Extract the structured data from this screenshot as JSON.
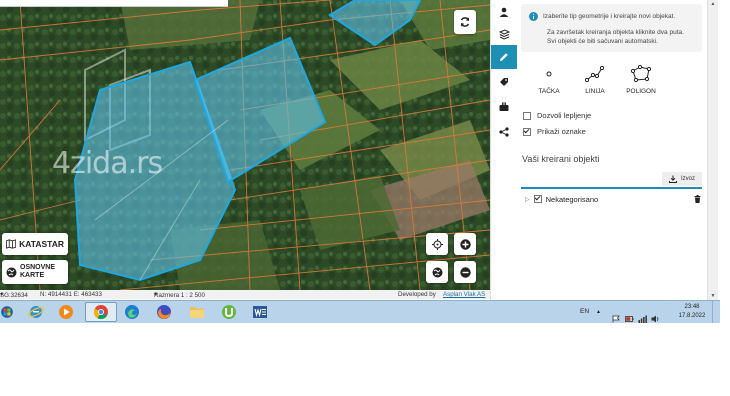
{
  "map": {
    "watermark": "4zida.rs",
    "buttons": {
      "refresh_icon": "refresh-icon",
      "locate_icon": "locate-icon",
      "zoom_in_icon": "plus-icon",
      "globe_icon": "globe-icon",
      "zoom_out_icon": "minus-icon"
    },
    "layers": {
      "katastar": "KATASTAR",
      "osnovne_line1": "OSNOVNE",
      "osnovne_line2": "KARTE"
    },
    "status": {
      "crs": "SG:32634",
      "coords": "N: 4914431 E: 463433",
      "scale": "Razmera 1 : 2 500",
      "developed_by": "Developed by",
      "developer": "Asplan Vlak AS"
    },
    "colors": {
      "parcel_fill": "#5fc3ea",
      "parcel_stroke": "#1ea8e0",
      "parcel_lines": "#e07b3a"
    }
  },
  "toolbar": {
    "items": [
      {
        "icon": "user-icon",
        "active": false
      },
      {
        "icon": "layers-icon",
        "active": false
      },
      {
        "icon": "pencil-icon",
        "active": true
      },
      {
        "icon": "tag-icon",
        "active": false
      },
      {
        "icon": "briefcase-icon",
        "active": false
      },
      {
        "icon": "share-icon",
        "active": false
      }
    ],
    "accent": "#1d8fb5"
  },
  "panel": {
    "info": {
      "line1": "Izaberite tip geometrije i kreirajte novi objekat.",
      "line2": "Za završetak kreiranja objekta kliknite dva puta.",
      "line3": "Svi objekti će biti sačuvani automatski."
    },
    "geometry": {
      "point": "TAČKA",
      "line": "LINIJA",
      "polygon": "POLIGON"
    },
    "options": {
      "snap": "Dozvoli lepljenje",
      "labels": "Prikaži oznake"
    },
    "objects_title": "Vaši kreirani objekti",
    "export_label": "Izvoz",
    "tree": {
      "group": "Nekategorisano"
    }
  },
  "taskbar": {
    "apps": [
      {
        "icon": "ie-icon"
      },
      {
        "icon": "media-player-icon"
      },
      {
        "icon": "chrome-icon",
        "active": true
      },
      {
        "icon": "edge-icon"
      },
      {
        "icon": "firefox-icon"
      },
      {
        "icon": "folder-icon"
      },
      {
        "icon": "torrent-icon"
      },
      {
        "icon": "word-icon"
      }
    ],
    "tray": {
      "lang": "EN",
      "time": "23:48",
      "date": "17.8.2022"
    }
  }
}
